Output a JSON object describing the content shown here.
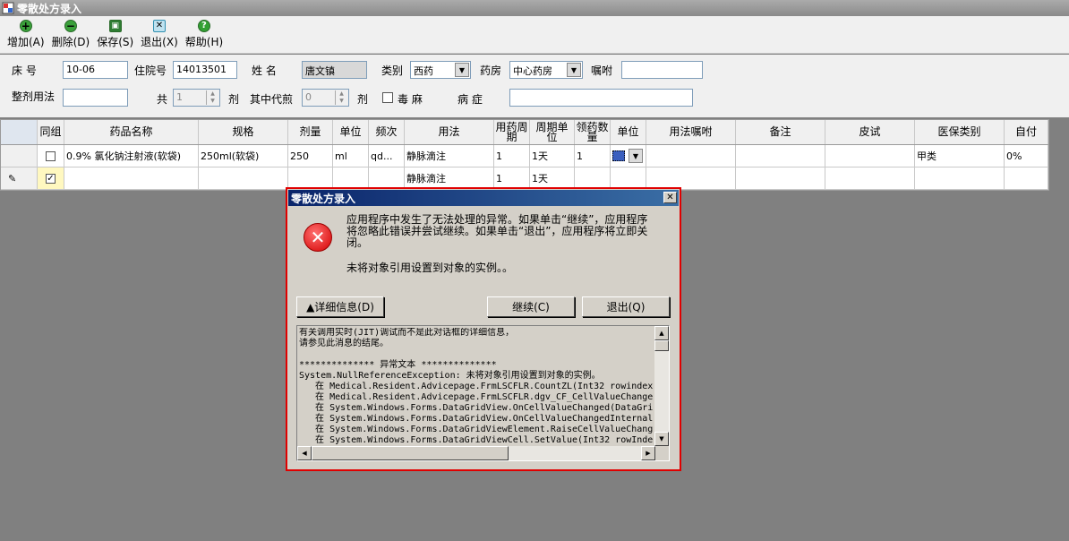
{
  "window": {
    "title": "零散处方录入"
  },
  "toolbar": {
    "buttons": [
      {
        "label": "增加(A)",
        "icon": "add-icon",
        "color": "#3aa03a",
        "glyph": "+"
      },
      {
        "label": "删除(D)",
        "icon": "delete-icon",
        "color": "#3aa03a",
        "glyph": "−"
      },
      {
        "label": "保存(S)",
        "icon": "save-icon",
        "color": "#2e7d32",
        "glyph": "▣"
      },
      {
        "label": "退出(X)",
        "icon": "exit-icon",
        "color": "#2f8fb0",
        "glyph": "⊠"
      },
      {
        "label": "帮助(H)",
        "icon": "help-icon",
        "color": "#33a033",
        "glyph": "?"
      }
    ]
  },
  "form": {
    "bed_label": "床    号",
    "bed_value": "10-06",
    "inpatient_label": "住院号",
    "inpatient_value": "14013501",
    "name_label": "姓    名",
    "name_value": "唐文镇",
    "category_label": "类别",
    "category_value": "西药",
    "pharmacy_label": "药房",
    "pharmacy_value": "中心药房",
    "instruction_label": "嘱咐",
    "instruction_value": "",
    "usage_label": "整剂用法",
    "usage_value": "",
    "total_label": "共",
    "total_value": "1",
    "dose_unit": "剂",
    "decoct_label": "其中代煎",
    "decoct_value": "0",
    "decoct_unit": "剂",
    "narcotic_label": "毒   麻",
    "disease_label": "病    症",
    "disease_value": ""
  },
  "grid": {
    "columns": [
      "同组",
      "药品名称",
      "规格",
      "剂量",
      "单位",
      "频次",
      "用法",
      "用药周期",
      "周期单位",
      "领药数量",
      "单位",
      "用法嘱咐",
      "备注",
      "皮试",
      "医保类别",
      "自付"
    ],
    "rows": [
      {
        "checked": false,
        "cells": [
          "0.9% 氯化钠注射液(软袋)",
          "250ml(软袋)",
          "250",
          "ml",
          "qd...",
          "静脉滴注",
          "1",
          "1天",
          "1",
          "",
          "",
          "",
          "",
          "甲类",
          "0%"
        ]
      },
      {
        "checked": true,
        "cells": [
          "",
          "",
          "",
          "",
          "",
          "静脉滴注",
          "1",
          "1天",
          "",
          "",
          "",
          "",
          "",
          "",
          ""
        ]
      }
    ]
  },
  "dialog": {
    "title": "零散处方录入",
    "message": "应用程序中发生了无法处理的异常。如果单击“继续”，应用程序将忽略此错误并尝试继续。如果单击“退出”，应用程序将立即关闭。",
    "detail_message": "未将对象引用设置到对象的实例。。",
    "details_button": "▲详细信息(D)",
    "continue_button": "继续(C)",
    "quit_button": "退出(Q)",
    "details_text": "有关调用实时(JIT)调试而不是此对话框的详细信息，\n请参见此消息的结尾。\n\n************** 异常文本 **************\nSystem.NullReferenceException: 未将对象引用设置到对象的实例。\n   在 Medical.Resident.Advicepage.FrmLSCFLR.CountZL(Int32 rowindex\n   在 Medical.Resident.Advicepage.FrmLSCFLR.dgv_CF_CellValueChange\n   在 System.Windows.Forms.DataGridView.OnCellValueChanged(DataGri\n   在 System.Windows.Forms.DataGridView.OnCellValueChangedInternal\n   在 System.Windows.Forms.DataGridViewElement.RaiseCellValueChang\n   在 System.Windows.Forms.DataGridViewCell.SetValue(Int32 rowInde"
  },
  "colors": {
    "highlight_border": "#e00000",
    "background": "#808080"
  }
}
